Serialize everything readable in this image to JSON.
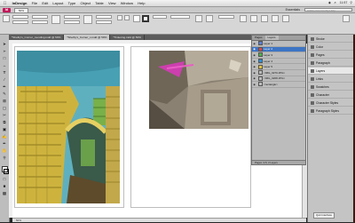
{
  "menubar": {
    "items": [
      "InDesign",
      "File",
      "Edit",
      "Layout",
      "Type",
      "Object",
      "Table",
      "View",
      "Window",
      "Help"
    ],
    "clock": "11:57"
  },
  "appbar": {
    "logo": "Id",
    "zoom": "50%",
    "workspace": "Essentials",
    "search_placeholder": "Adobe Community Help"
  },
  "tabs": [
    {
      "label": "*Shelby's_Corner_mending.indd @ 50%",
      "active": false
    },
    {
      "label": "*Shelby's_Corner_s.indd @ 50%",
      "active": true
    },
    {
      "label": "*Tinkering.indd @ 50%",
      "active": false
    }
  ],
  "layers_panel": {
    "tabs": [
      "Pages",
      "Layers"
    ],
    "layers": [
      {
        "name": "Layer 1",
        "color": "#5a7fd6",
        "selected": false
      },
      {
        "name": "Layer 2",
        "color": "#d14b4b",
        "selected": true
      },
      {
        "name": "Layer 3",
        "color": "#4fb04f",
        "selected": false
      },
      {
        "name": "Layer 4",
        "color": "#2c8ed6",
        "selected": false
      },
      {
        "name": "Layer 5",
        "color": "#e0c13a",
        "selected": false
      },
      {
        "name": "<IMG_0270.JPG>",
        "color": "#bbbbbb",
        "selected": false
      },
      {
        "name": "<IMG_0268.JPG>",
        "color": "#bbbbbb",
        "selected": false
      },
      {
        "name": "<rectangle>",
        "color": "#bbbbbb",
        "selected": false
      }
    ],
    "footer": "Pages: 4-5, 2 Layers"
  },
  "dock": {
    "items": [
      {
        "label": "Stroke",
        "selected": false
      },
      {
        "label": "Color",
        "selected": false
      },
      {
        "label": "Pages",
        "selected": false
      },
      {
        "label": "Paragraph",
        "selected": false
      },
      {
        "label": "Layers",
        "selected": true
      },
      {
        "label": "Links",
        "selected": false
      },
      {
        "label": "Swatches",
        "selected": false
      },
      {
        "label": "Character",
        "selected": false
      },
      {
        "label": "Character Styles",
        "selected": false
      },
      {
        "label": "Paragraph Styles",
        "selected": false
      }
    ],
    "bottom_button": "Quit Interface"
  },
  "status_bar": "50%"
}
